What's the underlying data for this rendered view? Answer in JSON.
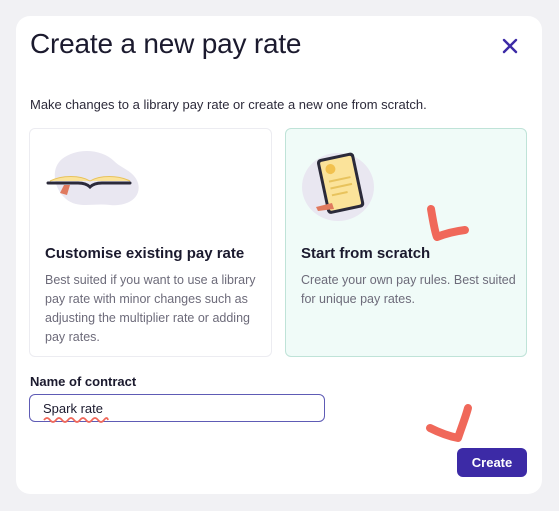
{
  "dialog": {
    "title": "Create a new pay rate",
    "subtitle": "Make changes to a library pay rate or create a new one from scratch."
  },
  "options": [
    {
      "title": "Customise existing pay rate",
      "description": "Best suited if you want to use a library pay rate with minor changes such as adjusting the multiplier rate or adding pay rates.",
      "selected": false,
      "icon": "open-book-icon"
    },
    {
      "title": "Start from scratch",
      "description": "Create your own pay rules. Best suited for unique pay rates.",
      "selected": true,
      "icon": "tablet-document-icon"
    }
  ],
  "form": {
    "contract_label": "Name of contract",
    "contract_value": "Spark rate"
  },
  "actions": {
    "create_label": "Create"
  },
  "colors": {
    "primary": "#3c2aa6",
    "selected_card_bg": "#f0fbf8",
    "selected_card_border": "#bfe3d8",
    "annotation_check": "#f0685a"
  }
}
